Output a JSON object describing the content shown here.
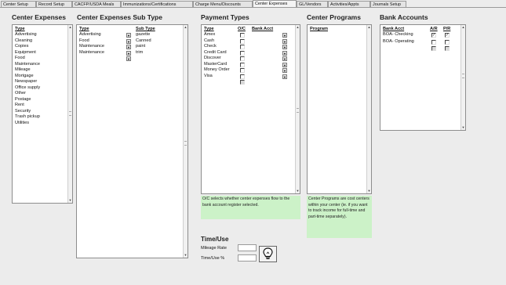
{
  "tabs": [
    {
      "label": "Center Setup",
      "active": false
    },
    {
      "label": "Record Setup",
      "active": false
    },
    {
      "label": "CACFP/USDA Meals",
      "active": false
    },
    {
      "label": "Immunizations/Certifications",
      "active": false
    },
    {
      "label": "Charge Menu/Discounts",
      "active": false
    },
    {
      "label": "Center Expenses",
      "active": true
    },
    {
      "label": "GL/Vendors",
      "active": false
    },
    {
      "label": "Activities/Appts",
      "active": false
    },
    {
      "label": "Journals Setup",
      "active": false
    }
  ],
  "center_expenses": {
    "title": "Center Expenses",
    "col_type": "Type",
    "items": [
      "Advertising",
      "Cleaning",
      "Copies",
      "Equipment",
      "Food",
      "Maintenance",
      "Mileage",
      "Mortgage",
      "Newspaper",
      "Office supply",
      "Other",
      "Postage",
      "Rent",
      "Security",
      "Trash pickup",
      "Utilities"
    ]
  },
  "sub_type": {
    "title": "Center Expenses Sub Type",
    "col_type": "Type",
    "col_sub": "Sub Type",
    "rows": [
      {
        "type": "Advertising",
        "sub": "gazette"
      },
      {
        "type": "Food",
        "sub": "Canned"
      },
      {
        "type": "Maintenance",
        "sub": "paint"
      },
      {
        "type": "Maintenance",
        "sub": "trim"
      }
    ]
  },
  "payment_types": {
    "title": "Payment Types",
    "col_type": "Type",
    "col_oc": "O/C",
    "col_bank": "Bank Acct",
    "items": [
      "Amex",
      "Cash",
      "Check",
      "Credit Card",
      "Discover",
      "MasterCard",
      "Money Order",
      "Visa"
    ],
    "note": "O/C selects whether center expenses flow to the bank account register selected."
  },
  "center_programs": {
    "title": "Center Programs",
    "col_program": "Program",
    "note": "Center Programs are cost centers within your center (ie. if you want to track income for full-time and part-time separately)."
  },
  "bank_accounts": {
    "title": "Bank Accounts",
    "col_bank": "Bank Acct",
    "col_ar": "A/R",
    "col_pr": "P/R",
    "rows": [
      {
        "name": "BOA- Checking",
        "ar": true,
        "pr": true
      },
      {
        "name": "BOA- Operating",
        "ar": false,
        "pr": false
      }
    ]
  },
  "time_use": {
    "title": "Time/Use",
    "mileage_label": "Mileage Rate",
    "time_label": "Time/Use %"
  },
  "icons": {
    "dropdown": "chevron-down-icon",
    "bulb": "lightbulb-icon"
  }
}
